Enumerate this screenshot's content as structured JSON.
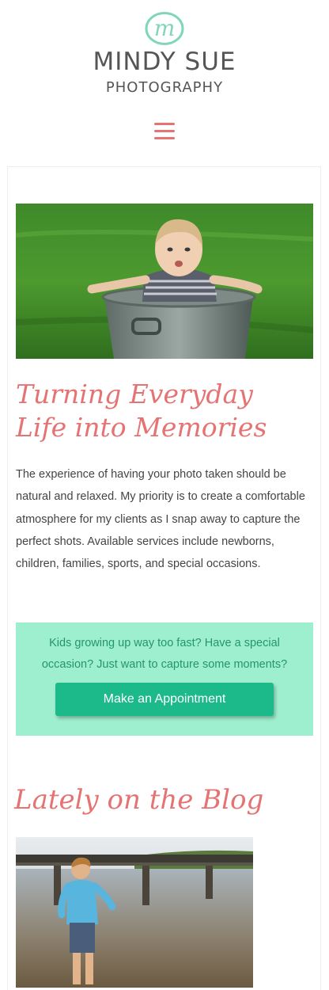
{
  "brand": {
    "logo_letter": "m",
    "name": "MINDY SUE",
    "subtitle": "PHOTOGRAPHY",
    "accent_color": "#e57373",
    "logo_color": "#7fd6b8"
  },
  "nav": {
    "menu_icon": "hamburger-menu-icon"
  },
  "hero": {
    "image": "baby-in-metal-tub-on-grass-photo",
    "heading": "Turning Everyday Life into Memories",
    "body": "The experience of having your photo taken should be natural and relaxed. My priority is to create a comfortable atmosphere for my clients as I snap away to capture the perfect shots. Available services include newborns, children, families, sports, and special occasions."
  },
  "cta": {
    "text": "Kids growing up way too fast? Have a special occasion? Just want to capture some moments?",
    "button_label": "Make an Appointment",
    "box_color": "#9eefcf",
    "button_color": "#1cba8a"
  },
  "blog": {
    "heading": "Lately on the Blog",
    "image": "boy-standing-in-lake-by-pier-photo"
  }
}
